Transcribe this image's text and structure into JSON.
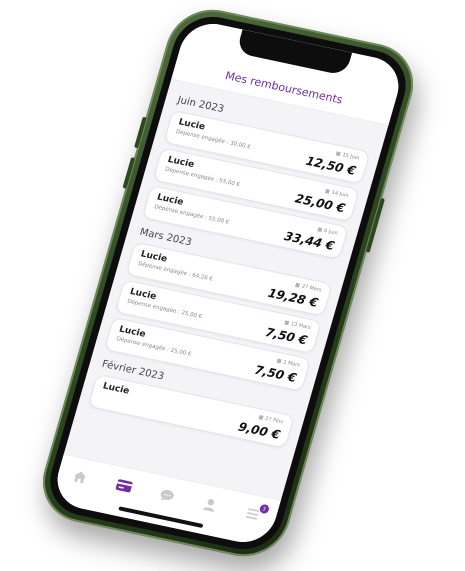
{
  "header": {
    "title": "Mes remboursements"
  },
  "months": [
    {
      "label": "Juin 2023",
      "items": [
        {
          "name": "Lucie",
          "engaged": "Dépense engagée : 30,00 €",
          "date": "15 Juin",
          "amount": "12,50 €"
        },
        {
          "name": "Lucie",
          "engaged": "Dépense engagée : 55,00 €",
          "date": "14 Juin",
          "amount": "25,00 €"
        },
        {
          "name": "Lucie",
          "engaged": "Dépense engagée : 55,00 €",
          "date": "6 Juin",
          "amount": "33,44 €"
        }
      ]
    },
    {
      "label": "Mars 2023",
      "items": [
        {
          "name": "Lucie",
          "engaged": "Dépense engagée : 64,26 €",
          "date": "27 Mars",
          "amount": "19,28 €"
        },
        {
          "name": "Lucie",
          "engaged": "Dépense engagée : 25,00 €",
          "date": "13 Mars",
          "amount": "7,50 €"
        },
        {
          "name": "Lucie",
          "engaged": "Dépense engagée : 25,00 €",
          "date": "1 Mars",
          "amount": "7,50 €"
        }
      ]
    },
    {
      "label": "Février 2023",
      "items": [
        {
          "name": "Lucie",
          "engaged": "",
          "date": "27 Févr",
          "amount": "9,00 €"
        }
      ]
    }
  ],
  "tabbar": {
    "items": [
      {
        "icon": "home-icon"
      },
      {
        "icon": "card-icon"
      },
      {
        "icon": "chat-icon"
      },
      {
        "icon": "profile-icon"
      },
      {
        "icon": "menu-icon",
        "badge": "3"
      }
    ]
  },
  "colors": {
    "accent": "#6f2da8",
    "phone_frame": "#2f4a22"
  }
}
